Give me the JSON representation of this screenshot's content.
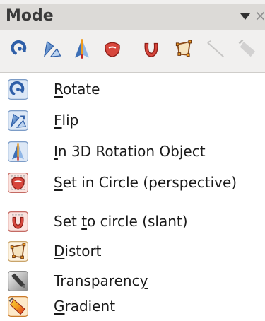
{
  "toolbar": {
    "title": "Mode",
    "menu_arrow_icon": "triangle-down-icon",
    "close_glyph": "×",
    "buttons": [
      {
        "name": "rotate",
        "icon": "rotate-icon",
        "enabled": true
      },
      {
        "name": "flip",
        "icon": "flip-icon",
        "enabled": true
      },
      {
        "name": "3d-rotation",
        "icon": "3d-rotation-icon",
        "enabled": true
      },
      {
        "name": "set-in-circle-perspective",
        "icon": "set-in-circle-perspective-icon",
        "enabled": true
      },
      {
        "name": "set-to-circle-slant",
        "icon": "set-to-circle-slant-icon",
        "enabled": true
      },
      {
        "name": "distort",
        "icon": "distort-icon",
        "enabled": true
      },
      {
        "name": "transparency",
        "icon": "transparency-icon",
        "enabled": false
      },
      {
        "name": "gradient",
        "icon": "gradient-icon",
        "enabled": false
      }
    ]
  },
  "menu": {
    "items": [
      {
        "before": "",
        "accel": "R",
        "after": "otate",
        "icon": "rotate-icon"
      },
      {
        "before": "",
        "accel": "F",
        "after": "lip",
        "icon": "flip-icon"
      },
      {
        "before": "",
        "accel": "I",
        "after": "n 3D Rotation Object",
        "icon": "3d-rotation-icon"
      },
      {
        "before": "",
        "accel": "S",
        "after": "et in Circle (perspective)",
        "icon": "set-in-circle-perspective-icon"
      },
      {
        "before": "Set ",
        "accel": "t",
        "after": "o circle (slant)",
        "icon": "set-to-circle-slant-icon"
      },
      {
        "before": "",
        "accel": "D",
        "after": "istort",
        "icon": "distort-icon"
      },
      {
        "before": "Transparenc",
        "accel": "y",
        "after": "",
        "icon": "transparency-icon"
      },
      {
        "before": "",
        "accel": "G",
        "after": "radient",
        "icon": "gradient-icon"
      }
    ]
  },
  "colors": {
    "titlebar_bg": "#dcdad7",
    "toolbar_bg": "#f1f0ef",
    "icon_blue": "#3d6fb6",
    "icon_red": "#c8281e",
    "gradient_orange": "#f39b1f"
  }
}
